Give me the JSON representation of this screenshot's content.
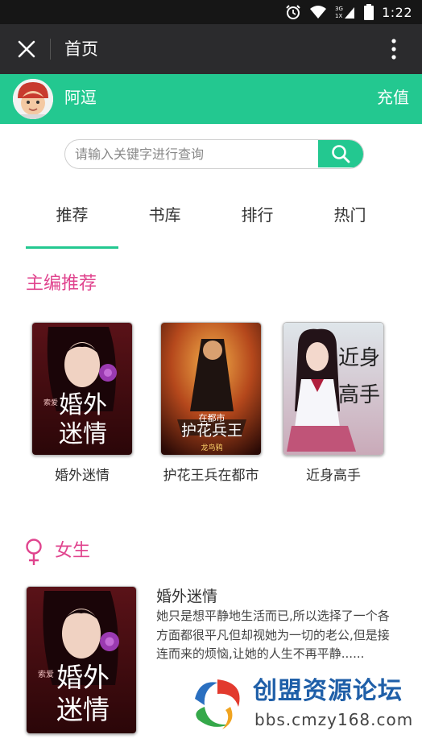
{
  "status_bar": {
    "time": "1:22",
    "network": "3G 1X",
    "icons": [
      "alarm-icon",
      "wifi-icon",
      "signal-icon",
      "battery-icon"
    ]
  },
  "title_bar": {
    "title": "首页",
    "close_icon": "close-icon",
    "more_icon": "more-vert-icon"
  },
  "user_bar": {
    "username": "阿逗",
    "recharge_label": "充值"
  },
  "search": {
    "placeholder": "请输入关键字进行查询",
    "value": "",
    "icon": "search-icon"
  },
  "tabs": [
    {
      "label": "推荐",
      "active": true
    },
    {
      "label": "书库",
      "active": false
    },
    {
      "label": "排行",
      "active": false
    },
    {
      "label": "热门",
      "active": false
    }
  ],
  "editor_picks": {
    "title": "主编推荐",
    "books": [
      {
        "name": "婚外迷情",
        "cover_text": [
          "婚外",
          "迷情"
        ],
        "cover_tag": "索爱"
      },
      {
        "name": "护花王兵在都市",
        "cover_text": [
          "在都市",
          "护花兵王"
        ],
        "cover_author": "龙鸟鸦"
      },
      {
        "name": "近身高手",
        "cover_text": [
          "近身",
          "高手"
        ]
      }
    ]
  },
  "female_section": {
    "title": "女生",
    "icon": "female-symbol-icon",
    "featured": {
      "title": "婚外迷情",
      "description": "她只是想平静地生活而已,所以选择了一个各方面都很平凡但却视她为一切的老公,但是接连而来的烦恼,让她的人生不再平静......",
      "cover_text": [
        "婚外",
        "迷情"
      ],
      "cover_tag": "索爱"
    }
  },
  "watermark": {
    "title": "创盟资源论坛",
    "url": "bbs.cmzy168.com"
  },
  "colors": {
    "accent_green": "#23c890",
    "section_pink": "#e0448e",
    "title_bar": "#2b2b2d",
    "status_bar": "#161616"
  }
}
